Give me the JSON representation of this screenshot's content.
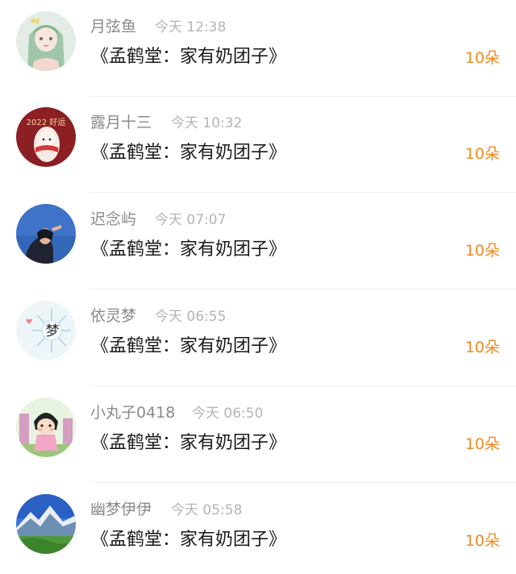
{
  "accent_color": "#f08a24",
  "items": [
    {
      "name": "月弦鱼",
      "time": "今天 12:38",
      "title": "《孟鹤堂：家有奶团子》",
      "count": "10朵",
      "avatar": "green-hair-girl-avatar"
    },
    {
      "name": "露月十三",
      "time": "今天 10:32",
      "title": "《孟鹤堂：家有奶团子》",
      "count": "10朵",
      "avatar": "red-2022-avatar"
    },
    {
      "name": "迟念屿",
      "time": "今天 07:07",
      "title": "《孟鹤堂：家有奶团子》",
      "count": "10朵",
      "avatar": "blue-sky-girl-avatar"
    },
    {
      "name": "依灵梦",
      "time": "今天 06:55",
      "title": "《孟鹤堂：家有奶团子》",
      "count": "10朵",
      "avatar": "snowflake-meng-avatar"
    },
    {
      "name": "小丸子0418",
      "time": "今天 06:50",
      "title": "《孟鹤堂：家有奶团子》",
      "count": "10朵",
      "avatar": "cartoon-girl-avatar"
    },
    {
      "name": "幽梦伊伊",
      "time": "今天 05:58",
      "title": "《孟鹤堂：家有奶团子》",
      "count": "10朵",
      "avatar": "mountain-landscape-avatar"
    }
  ],
  "avatar_texts": {
    "red_2022": "2022 好运",
    "snow_meng": "梦"
  }
}
